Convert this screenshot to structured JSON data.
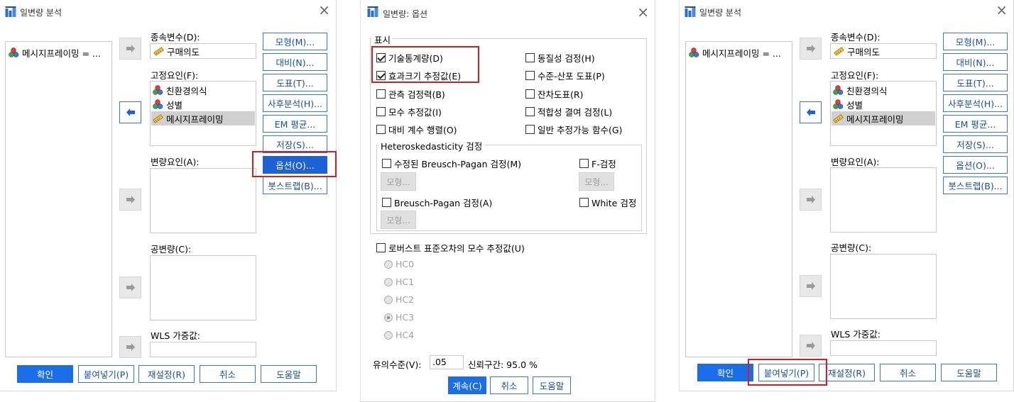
{
  "left_dialog": {
    "title": "일변량 분석",
    "source_items": [
      "메시지프레이밍 = ..."
    ],
    "dependent": {
      "label": "종속변수(D):",
      "value": "구매의도"
    },
    "fixed_factors": {
      "label": "고정요인(F):",
      "items": [
        "친환경의식",
        "성별",
        "메시지프레이밍"
      ],
      "selected": "메시지프레이밍"
    },
    "random_factors": {
      "label": "변량요인(A):"
    },
    "covariates": {
      "label": "공변량(C):"
    },
    "wls": {
      "label": "WLS 가중값:"
    },
    "side_buttons": [
      "모형(M)...",
      "대비(N)...",
      "도표(T)...",
      "사후분석(H)...",
      "EM 평균...",
      "저장(S)...",
      "옵션(O)...",
      "붓스트랩(B)..."
    ],
    "bottom_buttons": [
      "확인",
      "붙여넣기(P)",
      "재설정(R)",
      "취소",
      "도움말"
    ]
  },
  "options_dialog": {
    "title": "일변량: 옵션",
    "display_group": "표시",
    "left_checks": [
      {
        "label": "기술통계량(D)",
        "checked": true
      },
      {
        "label": "효과크기 추정값(E)",
        "checked": true
      },
      {
        "label": "관측 검정력(B)",
        "checked": false
      },
      {
        "label": "모수 추정값(I)",
        "checked": false
      },
      {
        "label": "대비 계수 행렬(O)",
        "checked": false
      }
    ],
    "right_checks": [
      {
        "label": "동질성 검정(H)",
        "checked": false
      },
      {
        "label": "수준-산포 도표(P)",
        "checked": false
      },
      {
        "label": "잔차도표(R)",
        "checked": false
      },
      {
        "label": "적합성 결여 검정(L)",
        "checked": false
      },
      {
        "label": "일반 추정가능 함수(G)",
        "checked": false
      }
    ],
    "hetero_group": "Heteroskedasticity 검정",
    "hetero": {
      "modified_bp": "수정된 Breusch-Pagan 검정(M)",
      "f_test": "F-검정",
      "bp": "Breusch-Pagan 검정(A)",
      "white": "White 검정",
      "model_btn": "모형..."
    },
    "robust": {
      "label": "로버스트 표준오차의 모수 추정값(U)",
      "checked": false
    },
    "hc_options": [
      "HC0",
      "HC1",
      "HC2",
      "HC3",
      "HC4"
    ],
    "hc_selected": "HC3",
    "significance": {
      "label": "유의수준(V):",
      "value": ".05",
      "ci_text": "신뢰구간: 95.0 %"
    },
    "buttons": [
      "계속(C)",
      "취소",
      "도움말"
    ]
  },
  "right_dialog": {
    "title": "일변량 분석",
    "source_items": [
      "메시지프레이밍 = ..."
    ],
    "dependent": {
      "label": "종속변수(D):",
      "value": "구매의도"
    },
    "fixed_factors": {
      "label": "고정요인(F):",
      "items": [
        "친환경의식",
        "성별",
        "메시지프레이밍"
      ]
    },
    "random_factors": {
      "label": "변량요인(A):"
    },
    "covariates": {
      "label": "공변량(C):"
    },
    "wls": {
      "label": "WLS 가중값:"
    },
    "side_buttons": [
      "모형(M)...",
      "대비(N)...",
      "도표(T)...",
      "사후분석(H)...",
      "EM 평균...",
      "저장(S)...",
      "옵션(O)...",
      "붓스트랩(B)..."
    ],
    "bottom_buttons": [
      "확인",
      "붙여넣기(P)",
      "재설정(R)",
      "취소",
      "도움말"
    ]
  },
  "colors": {
    "accent_blue": "#1a6fe8",
    "button_border": "#3b78c9",
    "highlight_red": "#d01f1f"
  }
}
